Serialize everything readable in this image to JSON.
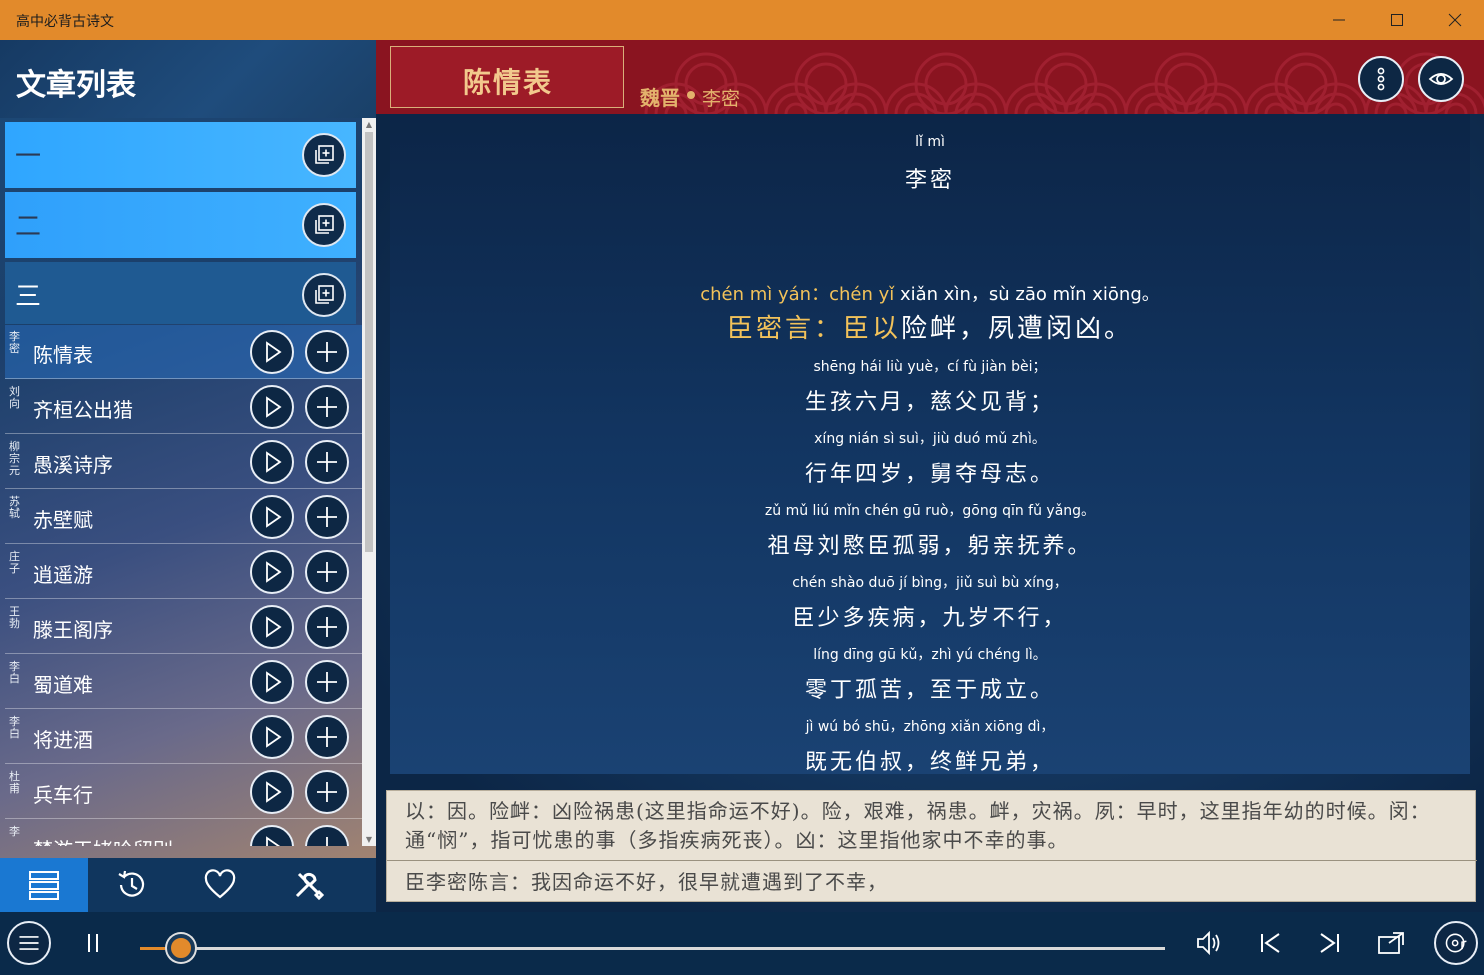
{
  "window": {
    "title": "高中必背古诗文",
    "controls": [
      "minimize-icon",
      "maximize-icon",
      "close-icon"
    ]
  },
  "sidebar": {
    "title": "文章列表",
    "groups": [
      {
        "label": "一",
        "button_icon": "add-collection-icon"
      },
      {
        "label": "二",
        "button_icon": "add-collection-icon"
      },
      {
        "label": "三",
        "button_icon": "add-collection-icon"
      }
    ],
    "poems": [
      {
        "author": "李密",
        "title": "陈情表"
      },
      {
        "author": "刘向",
        "title": "齐桓公出猎"
      },
      {
        "author": "柳宗元",
        "title": "愚溪诗序"
      },
      {
        "author": "苏轼",
        "title": "赤壁赋"
      },
      {
        "author": "庄子",
        "title": "逍遥游"
      },
      {
        "author": "王勃",
        "title": "滕王阁序"
      },
      {
        "author": "李白",
        "title": "蜀道难"
      },
      {
        "author": "李白",
        "title": "将进酒"
      },
      {
        "author": "杜甫",
        "title": "兵车行"
      },
      {
        "author": "李",
        "title": "梦游天姥吟留别"
      }
    ],
    "tabs": [
      {
        "icon": "list-icon",
        "active": true
      },
      {
        "icon": "history-icon",
        "active": false
      },
      {
        "icon": "heart-icon",
        "active": false
      },
      {
        "icon": "tools-icon",
        "active": false
      }
    ]
  },
  "poem": {
    "title": "陈情表",
    "dynasty": "魏晋",
    "author": "李密",
    "author_pinyin": "lǐ mì",
    "lines": [
      {
        "pinyin_hl": "chén mì yán：chén yǐ",
        "pinyin": " xiǎn xìn，sù zāo mǐn xiōng。",
        "hanzi_hl": "臣密言：臣以",
        "hanzi": "险衅，夙遭闵凶。"
      },
      {
        "pinyin_hl": "",
        "pinyin": "shēng hái liù yuè，cí fù jiàn bèi；",
        "hanzi_hl": "",
        "hanzi": "生孩六月，慈父见背；"
      },
      {
        "pinyin_hl": "",
        "pinyin": "xíng nián sì suì，jiù duó mǔ zhì。",
        "hanzi_hl": "",
        "hanzi": "行年四岁，舅夺母志。"
      },
      {
        "pinyin_hl": "",
        "pinyin": "zǔ mǔ liú mǐn chén gū ruò，gōng qīn fǔ yǎng。",
        "hanzi_hl": "",
        "hanzi": "祖母刘愍臣孤弱，躬亲抚养。"
      },
      {
        "pinyin_hl": "",
        "pinyin": "chén shào duō jí bìng，jiǔ suì bù xíng，",
        "hanzi_hl": "",
        "hanzi": "臣少多疾病，九岁不行，"
      },
      {
        "pinyin_hl": "",
        "pinyin": "líng dīng gū kǔ，zhì yú chéng lì。",
        "hanzi_hl": "",
        "hanzi": "零丁孤苦，至于成立。"
      },
      {
        "pinyin_hl": "",
        "pinyin": "jì wú bó shū，zhōng xiǎn xiōng dì，",
        "hanzi_hl": "",
        "hanzi": "既无伯叔，终鲜兄弟，"
      }
    ],
    "note": "以：因。险衅：凶险祸患(这里指命运不好)。险，艰难，祸患。衅，灾祸。夙：早时，这里指年幼的时候。闵：通“悯”，指可忧患的事（多指疾病死丧）。凶：这里指他家中不幸的事。",
    "translation": "臣李密陈言：我因命运不好，很早就遭遇到了不幸，"
  },
  "player": {
    "progress": 0.04,
    "icons": [
      "menu-icon",
      "pause-icon",
      "volume-icon",
      "previous-icon",
      "next-icon",
      "cast-icon",
      "music-disc-icon"
    ]
  },
  "colors": {
    "titlebar": "#e28a2b",
    "header_red": "#8a1420",
    "gold": "#e3b26c",
    "highlight": "#f2c25a",
    "active_tab": "#1a78d2"
  }
}
